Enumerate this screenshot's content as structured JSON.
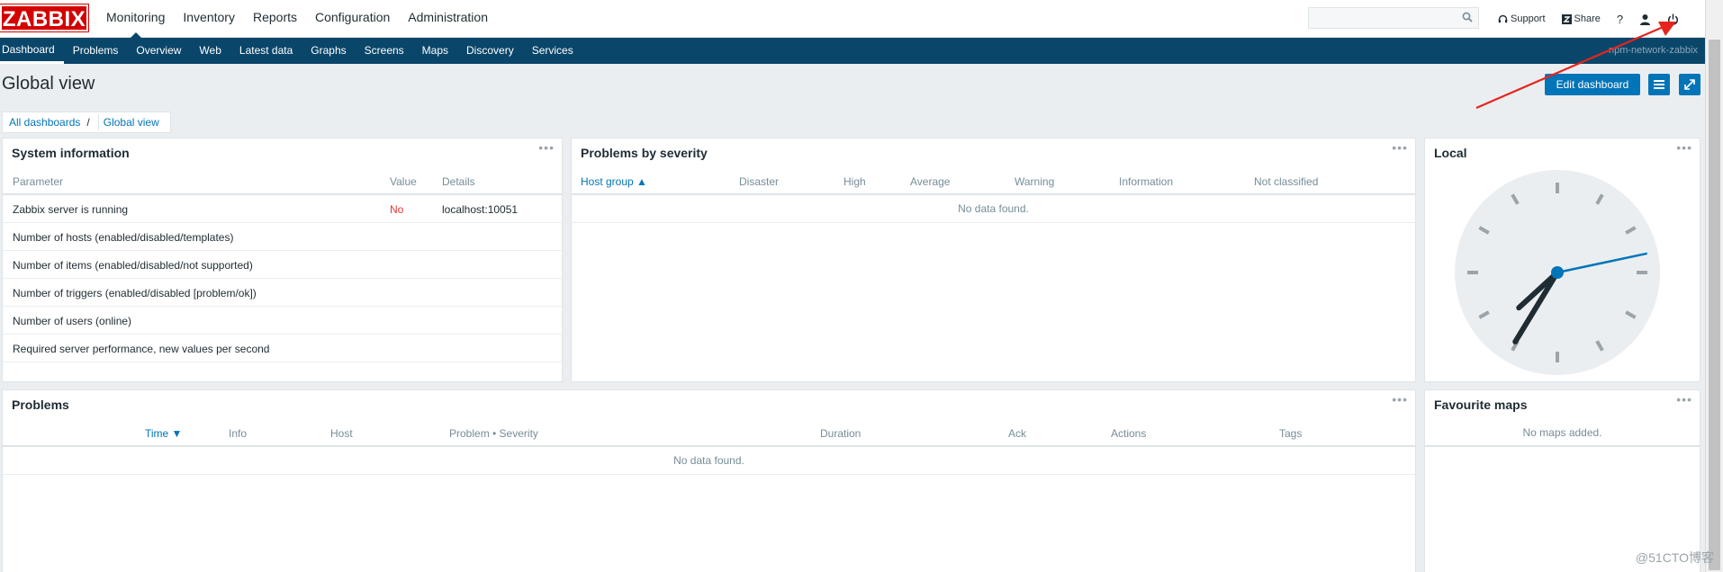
{
  "logo": "ZABBIX",
  "top_menu": [
    {
      "label": "Monitoring",
      "active": true
    },
    {
      "label": "Inventory"
    },
    {
      "label": "Reports"
    },
    {
      "label": "Configuration"
    },
    {
      "label": "Administration"
    }
  ],
  "search": {
    "placeholder": "",
    "icon": "search-icon"
  },
  "tools": {
    "support": "Support",
    "share": "Share",
    "help": "?",
    "user_icon": "user-icon",
    "logout_icon": "power-icon"
  },
  "sub_menu": [
    {
      "label": "Dashboard",
      "active": true
    },
    {
      "label": "Problems"
    },
    {
      "label": "Overview"
    },
    {
      "label": "Web"
    },
    {
      "label": "Latest data"
    },
    {
      "label": "Graphs"
    },
    {
      "label": "Screens"
    },
    {
      "label": "Maps"
    },
    {
      "label": "Discovery"
    },
    {
      "label": "Services"
    }
  ],
  "server_name": "npm-network-zabbix",
  "page_title": "Global view",
  "edit_dashboard": "Edit dashboard",
  "breadcrumb": {
    "root": "All dashboards",
    "separator": "/",
    "current": "Global view"
  },
  "system_information": {
    "title": "System information",
    "columns": [
      "Parameter",
      "Value",
      "Details"
    ],
    "rows": [
      {
        "parameter": "Zabbix server is running",
        "value": "No",
        "details": "localhost:10051"
      },
      {
        "parameter": "Number of hosts (enabled/disabled/templates)",
        "value": "",
        "details": ""
      },
      {
        "parameter": "Number of items (enabled/disabled/not supported)",
        "value": "",
        "details": ""
      },
      {
        "parameter": "Number of triggers (enabled/disabled [problem/ok])",
        "value": "",
        "details": ""
      },
      {
        "parameter": "Number of users (online)",
        "value": "",
        "details": ""
      },
      {
        "parameter": "Required server performance, new values per second",
        "value": "",
        "details": ""
      }
    ]
  },
  "problems_by_severity": {
    "title": "Problems by severity",
    "columns": [
      "Host group ▲",
      "Disaster",
      "High",
      "Average",
      "Warning",
      "Information",
      "Not classified"
    ],
    "empty": "No data found."
  },
  "local_clock": {
    "title": "Local",
    "hour": 7,
    "minute": 35,
    "second": 13
  },
  "problems": {
    "title": "Problems",
    "columns": [
      "Time ▼",
      "Info",
      "Host",
      "Problem • Severity",
      "Duration",
      "Ack",
      "Actions",
      "Tags"
    ],
    "empty": "No data found."
  },
  "favourite_maps": {
    "title": "Favourite maps",
    "empty": "No maps added."
  },
  "widget_menu": "•••",
  "watermark": "@51CTO博客",
  "colors": {
    "header": "#0a466a",
    "accent": "#0275b8",
    "logo": "#d40000",
    "error": "#e33734"
  }
}
